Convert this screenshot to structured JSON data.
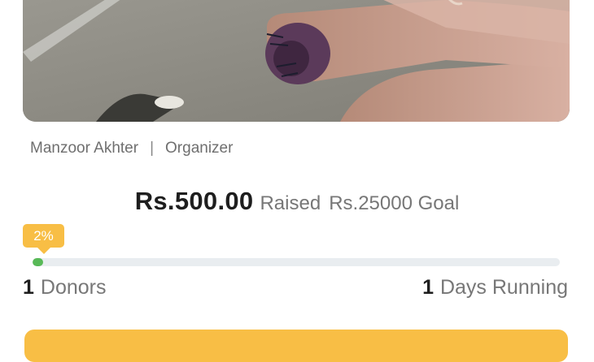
{
  "campaign": {
    "organizer_name": "Manzoor Akhter",
    "separator": "|",
    "organizer_role": "Organizer"
  },
  "funding": {
    "amount_raised": "Rs.500.00",
    "raised_label": "Raised",
    "goal_text": "Rs.25000 Goal",
    "percent_label": "2%",
    "progress_fraction": 0.02
  },
  "stats": {
    "donors_count": "1",
    "donors_label": "Donors",
    "days_count": "1",
    "days_label": "Days Running"
  },
  "colors": {
    "accent": "#f8be45",
    "progress": "#58b957",
    "track": "#e9edf0"
  }
}
